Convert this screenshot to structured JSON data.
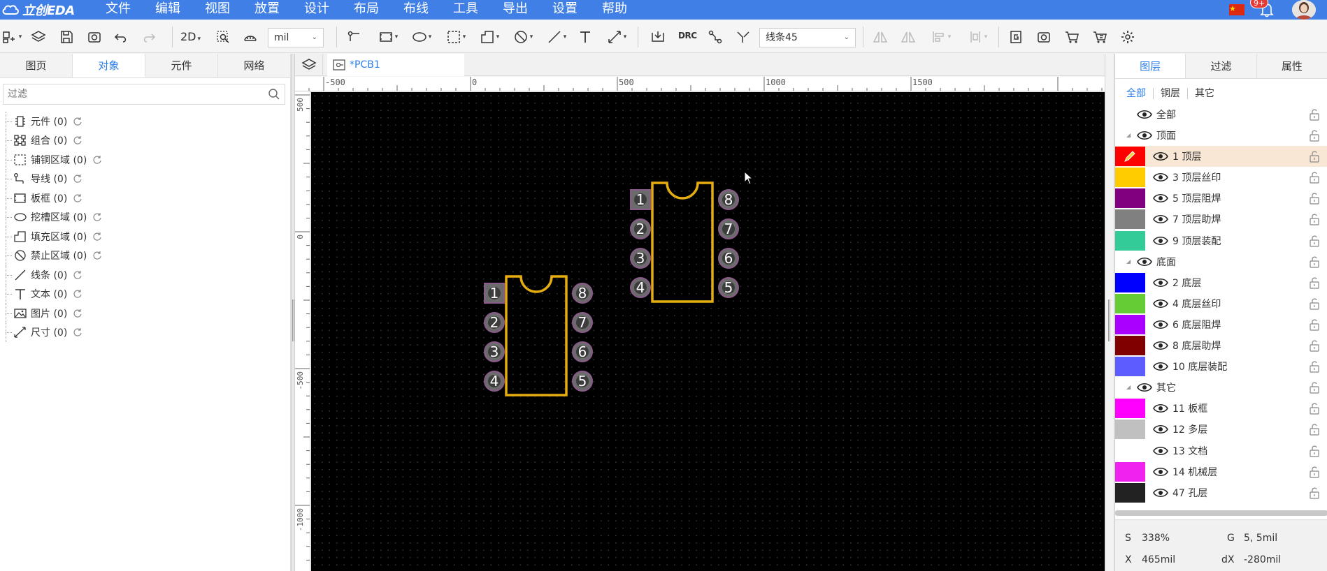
{
  "app": {
    "logo_text": "立创EDA"
  },
  "menus": [
    "文件",
    "编辑",
    "视图",
    "放置",
    "设计",
    "布局",
    "布线",
    "工具",
    "导出",
    "设置",
    "帮助"
  ],
  "notifications": {
    "badge": "9+"
  },
  "toolbar": {
    "view_mode": "2D",
    "unit": "mil",
    "route_mode": "线条45"
  },
  "left_panel": {
    "tabs": [
      "图页",
      "对象",
      "元件",
      "网络"
    ],
    "active_tab": "对象",
    "filter_placeholder": "过滤",
    "tree": [
      {
        "label": "元件 (0)",
        "icon": "component-icon"
      },
      {
        "label": "组合 (0)",
        "icon": "group-icon"
      },
      {
        "label": "铺铜区域 (0)",
        "icon": "copper-area-icon"
      },
      {
        "label": "导线 (0)",
        "icon": "track-icon"
      },
      {
        "label": "板框 (0)",
        "icon": "board-outline-icon"
      },
      {
        "label": "挖槽区域 (0)",
        "icon": "slot-area-icon"
      },
      {
        "label": "填充区域 (0)",
        "icon": "fill-area-icon"
      },
      {
        "label": "禁止区域 (0)",
        "icon": "keepout-area-icon"
      },
      {
        "label": "线条 (0)",
        "icon": "line-icon"
      },
      {
        "label": "文本 (0)",
        "icon": "text-icon"
      },
      {
        "label": "图片 (0)",
        "icon": "image-icon"
      },
      {
        "label": "尺寸 (0)",
        "icon": "dimension-icon"
      }
    ]
  },
  "document": {
    "tab_title": "*PCB1"
  },
  "rulers": {
    "top": [
      "-500",
      "0",
      "500",
      "1000",
      "1500"
    ],
    "left": [
      "500",
      "0",
      "-500",
      "-1000"
    ]
  },
  "canvas": {
    "chips": [
      {
        "pins_left": [
          "1",
          "2",
          "3",
          "4"
        ],
        "pins_right": [
          "8",
          "7",
          "6",
          "5"
        ]
      },
      {
        "pins_left": [
          "1",
          "2",
          "3",
          "4"
        ],
        "pins_right": [
          "8",
          "7",
          "6",
          "5"
        ]
      }
    ],
    "outline_color": "#e6ad11"
  },
  "right_panel": {
    "tabs": [
      "图层",
      "过滤",
      "属性"
    ],
    "active_tab": "图层",
    "filters": [
      "全部",
      "铜层",
      "其它"
    ],
    "active_filter": "全部",
    "layers": [
      {
        "type": "group",
        "name": "全部"
      },
      {
        "type": "group",
        "name": "顶面",
        "arrow": true
      },
      {
        "type": "layer",
        "name": "1 顶层",
        "color": "#ff0000",
        "selected": true,
        "edit": true
      },
      {
        "type": "layer",
        "name": "3 顶层丝印",
        "color": "#ffcc00"
      },
      {
        "type": "layer",
        "name": "5 顶层阻焊",
        "color": "#800080"
      },
      {
        "type": "layer",
        "name": "7 顶层助焊",
        "color": "#808080"
      },
      {
        "type": "layer",
        "name": "9 顶层装配",
        "color": "#33cc99"
      },
      {
        "type": "group",
        "name": "底面",
        "arrow": true
      },
      {
        "type": "layer",
        "name": "2 底层",
        "color": "#0000ff"
      },
      {
        "type": "layer",
        "name": "4 底层丝印",
        "color": "#66cc33"
      },
      {
        "type": "layer",
        "name": "6 底层阻焊",
        "color": "#aa00ff"
      },
      {
        "type": "layer",
        "name": "8 底层助焊",
        "color": "#800000"
      },
      {
        "type": "layer",
        "name": "10 底层装配",
        "color": "#5c5cff"
      },
      {
        "type": "group",
        "name": "其它",
        "arrow": true
      },
      {
        "type": "layer",
        "name": "11 板框",
        "color": "#ff00ff"
      },
      {
        "type": "layer",
        "name": "12 多层",
        "color": "#c0c0c0"
      },
      {
        "type": "layer",
        "name": "13 文档",
        "color": "#ffffff"
      },
      {
        "type": "layer",
        "name": "14 机械层",
        "color": "#f022f0"
      },
      {
        "type": "layer",
        "name": "47 孔层",
        "color": "#222222"
      }
    ],
    "status": {
      "s_label": "S",
      "s_value": "338%",
      "g_label": "G",
      "g_value": "5, 5mil",
      "x_label": "X",
      "x_value": "465mil",
      "dx_label": "dX",
      "dx_value": "-280mil"
    }
  }
}
